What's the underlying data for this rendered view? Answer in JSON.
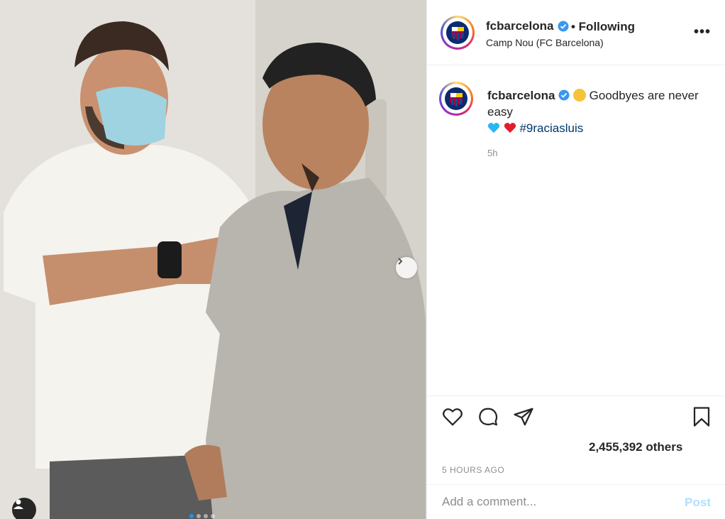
{
  "post": {
    "carousel_dots": 4,
    "active_dot": 0
  },
  "header": {
    "username": "fcbarcelona",
    "following": "• Following",
    "location": "Camp Nou (FC Barcelona)",
    "more_icon": "more-dots-icon"
  },
  "caption": {
    "username": "fcbarcelona",
    "text_line1": "Goodbyes are never easy",
    "hashtag": "#9raciasluis",
    "time": "5h"
  },
  "actions": {
    "likes": "2,455,392 others",
    "posted_ago": "5 HOURS AGO"
  },
  "comment": {
    "placeholder": "Add a comment...",
    "post_label": "Post"
  },
  "colors": {
    "verified": "#3897f0",
    "post_disabled": "#b2dffc",
    "hashtag": "#00376b"
  }
}
